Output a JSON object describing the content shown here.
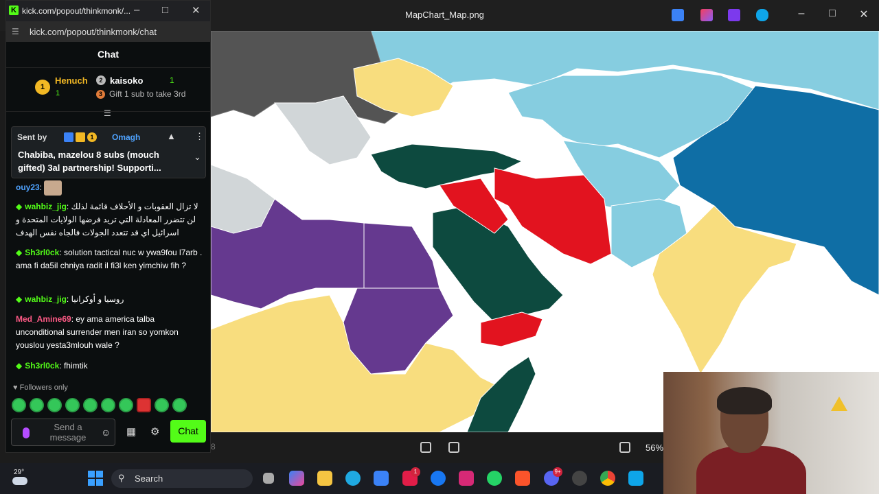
{
  "viewer": {
    "title": "MapChart_Map.png",
    "zoom": "56%",
    "stray_digit": "8"
  },
  "chat_window": {
    "tab_title": "kick.com/popout/thinkmonk/...",
    "url": "kick.com/popout/thinkmonk/chat",
    "header": "Chat",
    "gifters": [
      {
        "rank": "1",
        "name": "Henuch",
        "count": "1"
      },
      {
        "rank": "2",
        "name": "kaisoko",
        "count": "1",
        "note_rank": "3",
        "note": "Gift 1 sub to take 3rd"
      }
    ],
    "pinned": {
      "sent_by": "Sent by",
      "user": "Omagh",
      "badge_rank": "1",
      "text": "Chabiba, mazelou 8 subs (mouch gifted) 3al partnership! Supporti..."
    },
    "messages": [
      {
        "user": "ouy23",
        "color": "#4fa3ff",
        "text": ""
      },
      {
        "user": "wahbiz_jig",
        "color": "#53fc18",
        "text": "لا تزال العقوبات و الأحلاف قائمة لذلك لن تتضرر المعادلة التي تريد فرضها الولايات المتحدة و اسرائيل اي قد تتعدد الجولات فالجاه نفس الهدف"
      },
      {
        "user": "Sh3rl0ck",
        "color": "#53fc18",
        "text": "solution tactical nuc w ywa9fou l7arb . ama fi da5il chniya radit il fi3l ken yimchiw fih ?"
      },
      {
        "user": "wahbiz_jig",
        "color": "#53fc18",
        "text": "روسيا و أوكرانيا"
      },
      {
        "user": "Med_Amine69",
        "color": "#ff5a86",
        "text": "ey ama america talba unconditional surrender men iran so yomkon youslou yesta3mlouh wale ?"
      },
      {
        "user": "Sh3rl0ck",
        "color": "#53fc18",
        "text": "fhimtik"
      }
    ],
    "followers_only": "Followers only",
    "input_placeholder": "Send a message",
    "send_label": "Chat"
  },
  "taskbar": {
    "temperature": "29°",
    "search_label": "Search",
    "apps": [
      {
        "name": "file-explorer-icon",
        "color": "#f5c542"
      },
      {
        "name": "edge-icon",
        "color": "#1fa9e1"
      },
      {
        "name": "store-icon",
        "color": "#3b82f6"
      },
      {
        "name": "app-l-icon",
        "color": "#e11d48",
        "badge": "1"
      },
      {
        "name": "facebook-icon",
        "color": "#1877f2"
      },
      {
        "name": "instagram-icon",
        "color": "#d62976"
      },
      {
        "name": "whatsapp-icon",
        "color": "#25d366"
      },
      {
        "name": "brave-icon",
        "color": "#fb542b"
      },
      {
        "name": "discord-icon",
        "color": "#5865f2",
        "badge": "9+"
      },
      {
        "name": "obs-icon",
        "color": "#444"
      },
      {
        "name": "chrome-icon",
        "color": "#fbbc05"
      },
      {
        "name": "photos-icon",
        "color": "#0ea5e9"
      }
    ]
  },
  "map_colors": {
    "white": "#ffffff",
    "light_blue": "#86cde0",
    "teal": "#2f9cc6",
    "dark_blue": "#0f6ea5",
    "dark_gray": "#545454",
    "light_gray": "#d1d6d8",
    "yellow": "#f8dd7e",
    "dark_green": "#0d4a3f",
    "red": "#e2131f",
    "purple": "#65398f"
  }
}
